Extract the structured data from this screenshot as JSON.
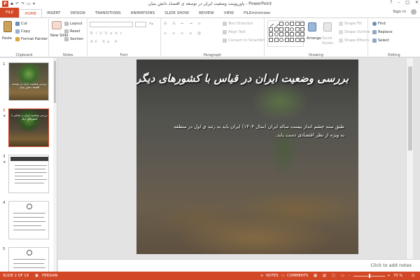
{
  "window": {
    "title": "پاورپوینت وضعیت ایران در توسعه ی اقتصاد دانش بنیان - PowerPoint",
    "controls": [
      "?",
      "–",
      "□",
      "✕"
    ],
    "signin": "Sign in"
  },
  "tabs": [
    "FILE",
    "HOME",
    "INSERT",
    "DESIGN",
    "TRANSITIONS",
    "ANIMATIONS",
    "SLIDE SHOW",
    "REVIEW",
    "VIEW",
    "FILEminimizer"
  ],
  "ribbon": {
    "clipboard": {
      "label": "Clipboard",
      "paste": "Paste",
      "cut": "Cut",
      "copy": "Copy",
      "format_painter": "Format Painter"
    },
    "slides": {
      "label": "Slides",
      "new_slide": "New Slide",
      "layout": "Layout",
      "reset": "Reset",
      "section": "Section"
    },
    "font": {
      "label": "Font"
    },
    "paragraph": {
      "label": "Paragraph",
      "text_direction": "Text Direction",
      "align_text": "Align Text",
      "convert_smartart": "Convert to SmartArt"
    },
    "drawing": {
      "label": "Drawing",
      "arrange": "Arrange",
      "quick_styles": "Quick Styles",
      "shape_fill": "Shape Fill",
      "shape_outline": "Shape Outline",
      "shape_effects": "Shape Effects"
    },
    "editing": {
      "label": "Editing",
      "find": "Find",
      "replace": "Replace",
      "select": "Select"
    }
  },
  "thumbnails": [
    {
      "num": "1",
      "title": "بررسی وضعیت ایران در توسعه اقتصاد دانش بنیان"
    },
    {
      "num": "2",
      "title": "بررسی وضعیت ایران در قیاس با کشورهای دیگر"
    },
    {
      "num": "3"
    },
    {
      "num": "4"
    },
    {
      "num": "5"
    }
  ],
  "slide": {
    "title": "بررسی وضعیت ایران در قیاس با کشورهای دیگر",
    "body": "طبق سند چشم انداز بیست ساله ایران (سال ۱۴۰۴) ایران باید به رتبه ی اول در منطقه به ویژه از نظر اقتصادی دست یابد."
  },
  "notes_placeholder": "Click to add notes",
  "status": {
    "slide_indicator": "SLIDE 2 OF 19",
    "language": "PERSIAN",
    "notes": "NOTES",
    "comments": "COMMENTS",
    "zoom": "70 %"
  },
  "colors": {
    "accent": "#d24726"
  }
}
